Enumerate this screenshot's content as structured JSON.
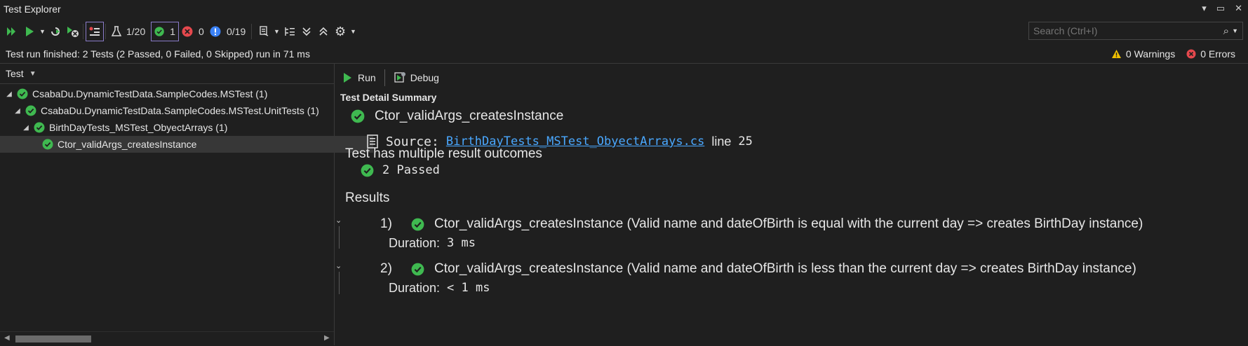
{
  "window": {
    "title": "Test Explorer"
  },
  "toolbar": {
    "passed_group_label": "1/20",
    "passed_filter_count": "1",
    "failed_count": "0",
    "not_run_count": "0/19"
  },
  "search": {
    "placeholder": "Search (Ctrl+I)"
  },
  "status": {
    "message": "Test run finished: 2 Tests (2 Passed, 0 Failed, 0 Skipped) run in 71 ms",
    "warnings": "0 Warnings",
    "errors": "0 Errors"
  },
  "tree": {
    "column_header": "Test",
    "items": [
      {
        "label": "CsabaDu.DynamicTestData.SampleCodes.MSTest (1)"
      },
      {
        "label": "CsabaDu.DynamicTestData.SampleCodes.MSTest.UnitTests (1)"
      },
      {
        "label": "BirthDayTests_MSTest_ObyectArrays (1)"
      },
      {
        "label": "Ctor_validArgs_createsInstance"
      }
    ]
  },
  "detail": {
    "run_label": "Run",
    "debug_label": "Debug",
    "section_title": "Test Detail Summary",
    "test_name": "Ctor_validArgs_createsInstance",
    "source_label": "Source:",
    "source_file": "BirthDayTests_MSTest_ObyectArrays.cs",
    "line_label": "line",
    "line_number": "25",
    "outcomes_title": "Test has multiple result outcomes",
    "passed_summary": "2 Passed",
    "results_title": "Results",
    "results": [
      {
        "index": "1)",
        "title": "Ctor_validArgs_createsInstance (Valid name and dateOfBirth is equal with the current day => creates BirthDay instance)",
        "duration_label": "Duration:",
        "duration": "3 ms"
      },
      {
        "index": "2)",
        "title": "Ctor_validArgs_createsInstance (Valid name and dateOfBirth is less than the current day => creates BirthDay instance)",
        "duration_label": "Duration:",
        "duration": "< 1 ms"
      }
    ]
  },
  "colors": {
    "pass": "#3fb950",
    "fail": "#e5484d",
    "info": "#3b82f6",
    "warning": "#f0c000",
    "link": "#4aa8ff",
    "accent_border": "#8a7cc9"
  }
}
